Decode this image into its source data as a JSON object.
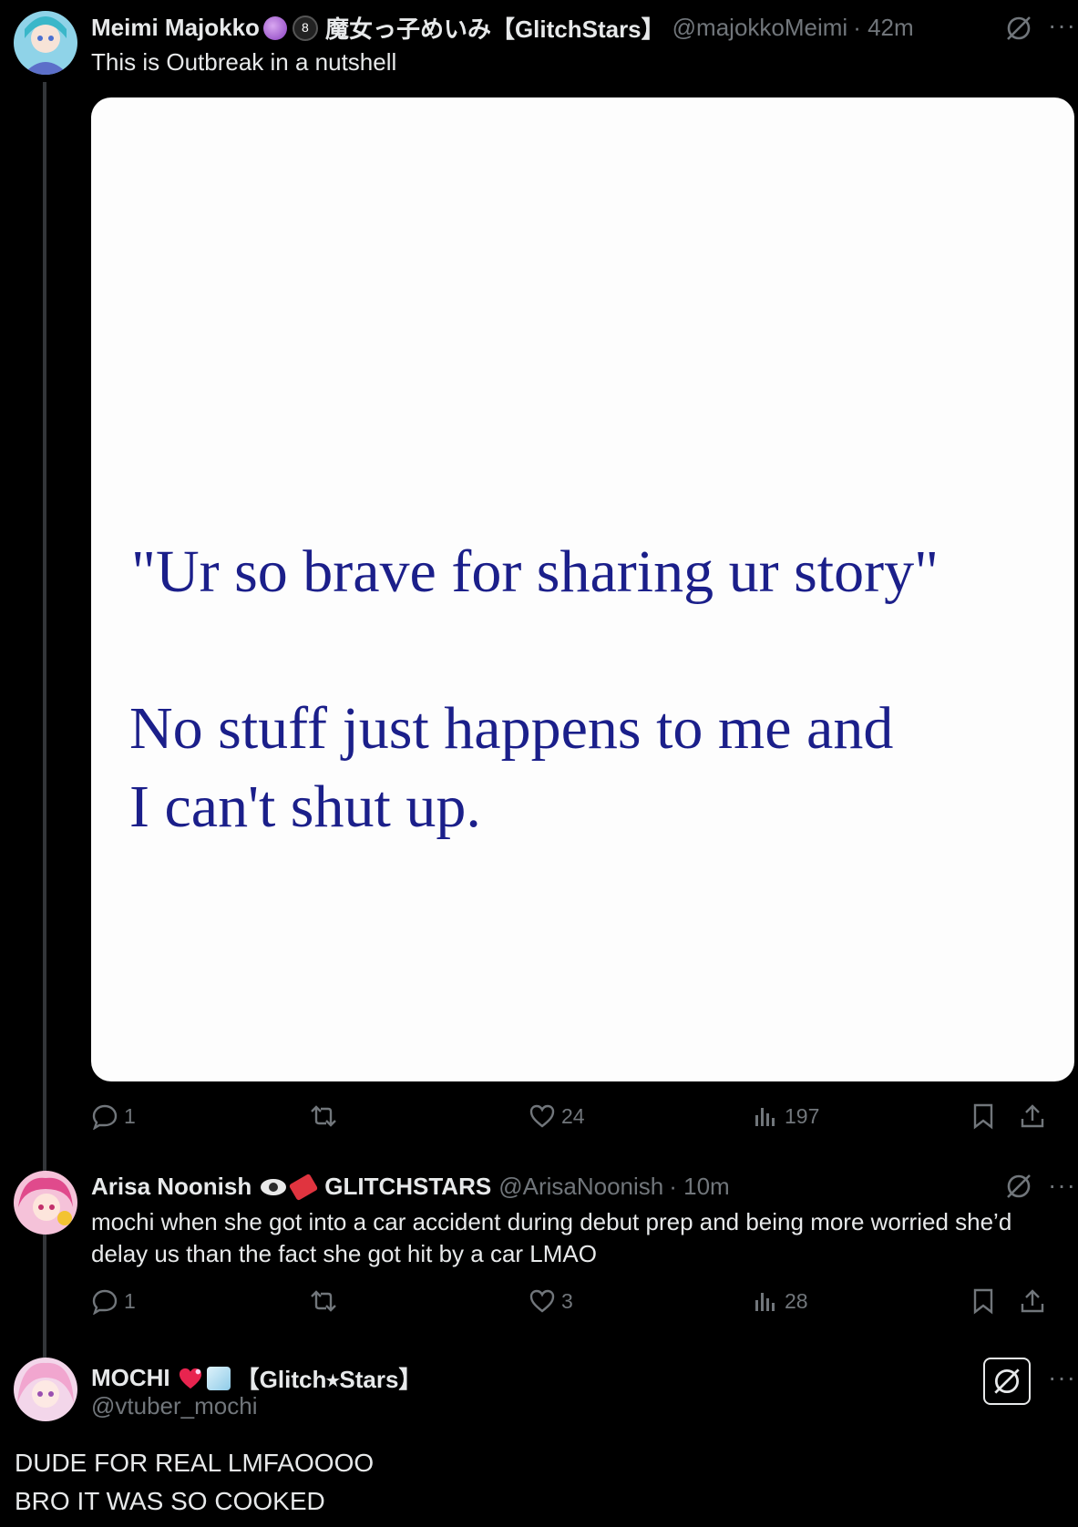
{
  "tweet1": {
    "name": "Meimi Majokko",
    "name_jp": "魔女っ子めいみ【GlitchStars】",
    "handle": "@majokkoMeimi",
    "time": "· 42m",
    "text": "This is Outbreak in a nutshell",
    "media": {
      "line1": "\"Ur so brave for sharing ur story\"",
      "line2": "No stuff just happens to me and",
      "line3": "I can't shut up."
    },
    "replies": "1",
    "retweets": "",
    "likes": "24",
    "views": "197"
  },
  "tweet2": {
    "name": "Arisa Noonish",
    "name_suffix": "GLITCHSTARS",
    "handle": "@ArisaNoonish",
    "time": "· 10m",
    "text_line1": "mochi when she got into a car accident during debut prep and being more worried she’d",
    "text_line2": "delay us than the fact she got hit by a car LMAO",
    "replies": "1",
    "retweets": "",
    "likes": "3",
    "views": "28"
  },
  "tweet3": {
    "name": "MOCHI",
    "name_suffix": "【Glitch⭑Stars】",
    "handle": "@vtuber_mochi",
    "text_line1": "DUDE FOR REAL LMFAOOOO",
    "text_line2": "BRO IT WAS SO COOKED"
  },
  "colors": {
    "background": "#000000",
    "text": "#e7e9ea",
    "muted": "#71767b",
    "media_text": "#1b1f8a"
  }
}
